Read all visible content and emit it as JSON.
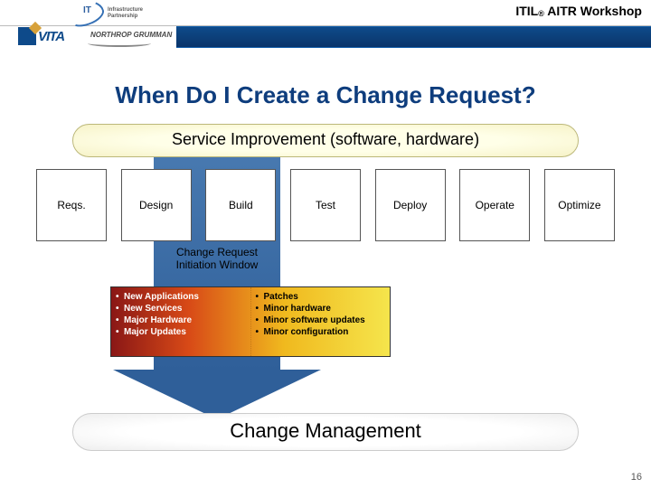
{
  "header": {
    "title_prefix": "ITIL",
    "title_reg": "®",
    "title_suffix": " AITR Workshop",
    "itp_line1": "Infrastructure",
    "itp_line2": "Partnership",
    "vita_text": "VITA",
    "ng_text": "NORTHROP GRUMMAN"
  },
  "slide": {
    "title": "When Do I Create a Change Request?"
  },
  "diagram": {
    "top_pill": "Service Improvement (software, hardware)",
    "bottom_pill": "Change Management",
    "stages": [
      "Reqs.",
      "Design",
      "Build",
      "Test",
      "Deploy",
      "Operate",
      "Optimize"
    ],
    "crw_line1": "Change Request",
    "crw_line2": "Initiation Window",
    "left_items": [
      "New Applications",
      "New Services",
      "Major Hardware",
      "Major Updates"
    ],
    "right_items": [
      "Patches",
      "Minor hardware",
      "Minor software updates",
      "Minor configuration"
    ]
  },
  "page_number": "16"
}
